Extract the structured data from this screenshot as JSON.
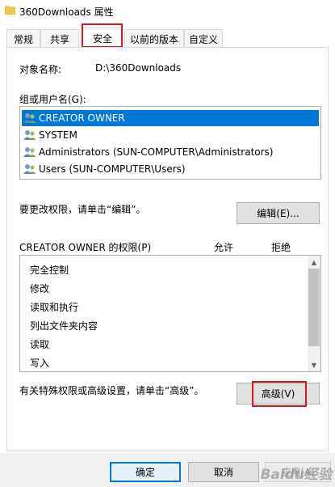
{
  "window": {
    "title": "360Downloads 属性"
  },
  "tabs": [
    {
      "label": "常规"
    },
    {
      "label": "共享"
    },
    {
      "label": "安全"
    },
    {
      "label": "以前的版本"
    },
    {
      "label": "自定义"
    }
  ],
  "security": {
    "object_name_label": "对象名称:",
    "object_name_value": "D:\\360Downloads",
    "group_label": "组或用户名(G):",
    "users": [
      {
        "name": "CREATOR OWNER",
        "selected": true
      },
      {
        "name": "SYSTEM",
        "selected": false
      },
      {
        "name": "Administrators (SUN-COMPUTER\\Administrators)",
        "selected": false
      },
      {
        "name": "Users (SUN-COMPUTER\\Users)",
        "selected": false
      }
    ],
    "edit_hint": "要更改权限，请单击“编辑”。",
    "edit_button": "编辑(E)...",
    "perm_header": "CREATOR OWNER 的权限(P)",
    "allow_header": "允许",
    "deny_header": "拒绝",
    "permissions": [
      "完全控制",
      "修改",
      "读取和执行",
      "列出文件夹内容",
      "读取",
      "写入"
    ],
    "advanced_hint": "有关特殊权限或高级设置，请单击“高级”。",
    "advanced_button": "高级(V)"
  },
  "footer": {
    "ok": "确定",
    "cancel": "取消",
    "apply": "应用(A)"
  },
  "watermark": "Baidu经验",
  "colors": {
    "highlight_red": "#e0141e",
    "selection_blue": "#0078d7"
  }
}
